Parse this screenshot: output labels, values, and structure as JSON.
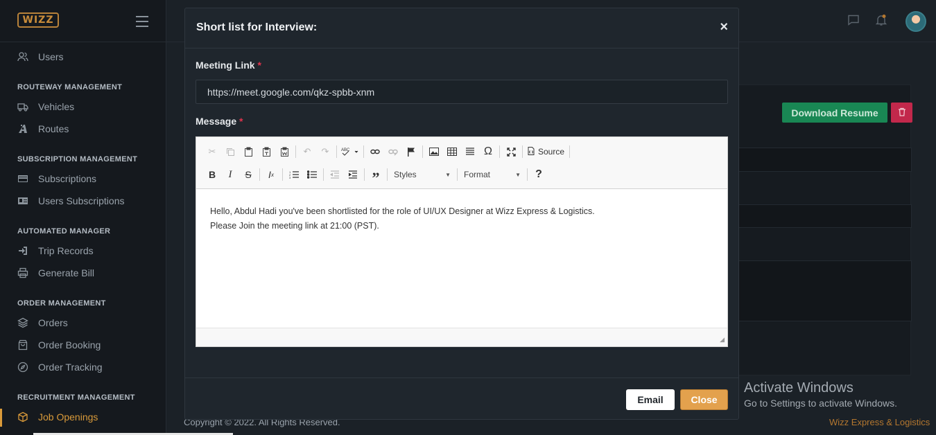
{
  "brand": {
    "logo_text": "WIZZ"
  },
  "sidebar": {
    "items": [
      {
        "label": "Users",
        "icon": "users-icon"
      },
      {
        "section": "ROUTEWAY MANAGEMENT"
      },
      {
        "label": "Vehicles",
        "icon": "truck-icon"
      },
      {
        "label": "Routes",
        "icon": "road-icon"
      },
      {
        "section": "SUBSCRIPTION MANAGEMENT"
      },
      {
        "label": "Subscriptions",
        "icon": "credit-card-icon"
      },
      {
        "label": "Users Subscriptions",
        "icon": "id-card-icon"
      },
      {
        "section": "AUTOMATED MANAGER"
      },
      {
        "label": "Trip Records",
        "icon": "sign-in-icon"
      },
      {
        "label": "Generate Bill",
        "icon": "printer-icon"
      },
      {
        "section": "ORDER MANAGEMENT"
      },
      {
        "label": "Orders",
        "icon": "layers-icon"
      },
      {
        "label": "Order Booking",
        "icon": "shopping-bag-icon"
      },
      {
        "label": "Order Tracking",
        "icon": "compass-icon"
      },
      {
        "section": "RECRUITMENT MANAGEMENT"
      },
      {
        "label": "Job Openings",
        "icon": "cube-icon",
        "active": true
      }
    ]
  },
  "background": {
    "download_resume": "Download Resume",
    "footer_left": "Copyright © 2022. All Rights Reserved.",
    "footer_right": "Wizz Express & Logistics",
    "activate_title": "Activate Windows",
    "activate_sub": "Go to Settings to activate Windows."
  },
  "modal": {
    "title": "Short list for Interview:",
    "close_symbol": "×",
    "meeting_link_label": "Meeting Link",
    "meeting_link_value": "https://meet.google.com/qkz-spbb-xnm",
    "message_label": "Message",
    "required_mark": "*",
    "editor": {
      "styles_label": "Styles",
      "format_label": "Format",
      "source_label": "Source",
      "help_symbol": "?",
      "content_line1": "Hello, Abdul Hadi you've been shortlisted for the role of UI/UX Designer at Wizz Express & Logistics.",
      "content_line2": "Please Join the meeting link at 21:00 (PST)."
    },
    "email_button": "Email",
    "close_button": "Close"
  },
  "colors": {
    "accent": "#d99a3a",
    "success": "#198754",
    "danger": "#c2284b",
    "close_button": "#e3a14d",
    "required": "#e0344d"
  }
}
